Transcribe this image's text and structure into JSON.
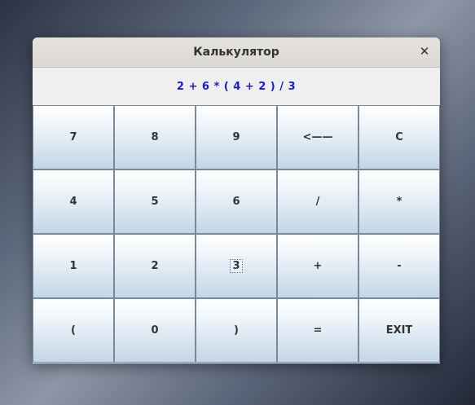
{
  "window": {
    "title": "Калькулятор",
    "close_glyph": "✕"
  },
  "display": {
    "expression": "2 + 6 * ( 4 + 2 ) / 3",
    "text_color": "#1a1ad6"
  },
  "keys": [
    [
      "7",
      "8",
      "9",
      "<——",
      "C"
    ],
    [
      "4",
      "5",
      "6",
      "/",
      "*"
    ],
    [
      "1",
      "2",
      "3",
      "+",
      "-"
    ],
    [
      "(",
      "0",
      ")",
      "=",
      "EXIT"
    ]
  ],
  "focused_key": "3"
}
